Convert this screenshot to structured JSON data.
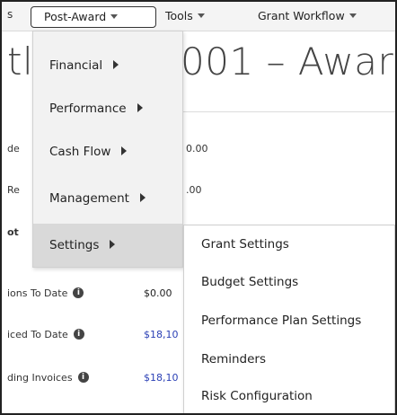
{
  "navbar": {
    "edge_char": "s",
    "items": [
      {
        "label": "Post-Award"
      },
      {
        "label": "Tools"
      },
      {
        "label": "Grant Workflow"
      }
    ]
  },
  "page": {
    "title_left": "tl",
    "title_right": "001 – Award",
    "rows": [
      {
        "label": "de",
        "value": "0.00"
      },
      {
        "label": "Re",
        "value": ".00"
      },
      {
        "label": "ot"
      },
      {
        "label": "ions To Date",
        "value": "$0.00"
      },
      {
        "label": "iced To Date",
        "value": "$18,10"
      },
      {
        "label": "ding Invoices",
        "value": "$18,10"
      }
    ],
    "info_glyph": "i"
  },
  "menu": {
    "items": [
      {
        "label": "Financial"
      },
      {
        "label": "Performance"
      },
      {
        "label": "Cash Flow"
      },
      {
        "label": "Management"
      },
      {
        "label": "Settings"
      }
    ]
  },
  "submenu": {
    "items": [
      {
        "label": "Grant Settings"
      },
      {
        "label": "Budget Settings"
      },
      {
        "label": "Performance Plan Settings"
      },
      {
        "label": "Reminders"
      },
      {
        "label": "Risk Configuration"
      }
    ]
  },
  "colors": {
    "link": "#2a3fb5",
    "menu_bg": "#f2f2f2",
    "menu_active": "#d9d9d9"
  }
}
